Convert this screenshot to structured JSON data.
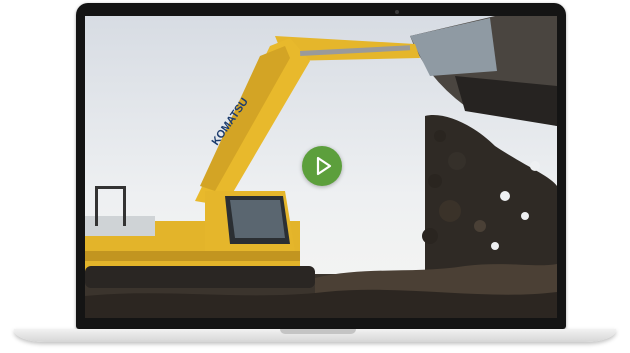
{
  "device": {
    "type": "laptop"
  },
  "video": {
    "thumbnail": "excavator-digging-photo",
    "brand_text": "KOMATSU",
    "colors": {
      "sky": "#dfe3e8",
      "machine": "#e5b62b",
      "soil": "#3b342d"
    }
  },
  "play_button": {
    "icon": "play-icon",
    "color": "#5c9f3c"
  }
}
